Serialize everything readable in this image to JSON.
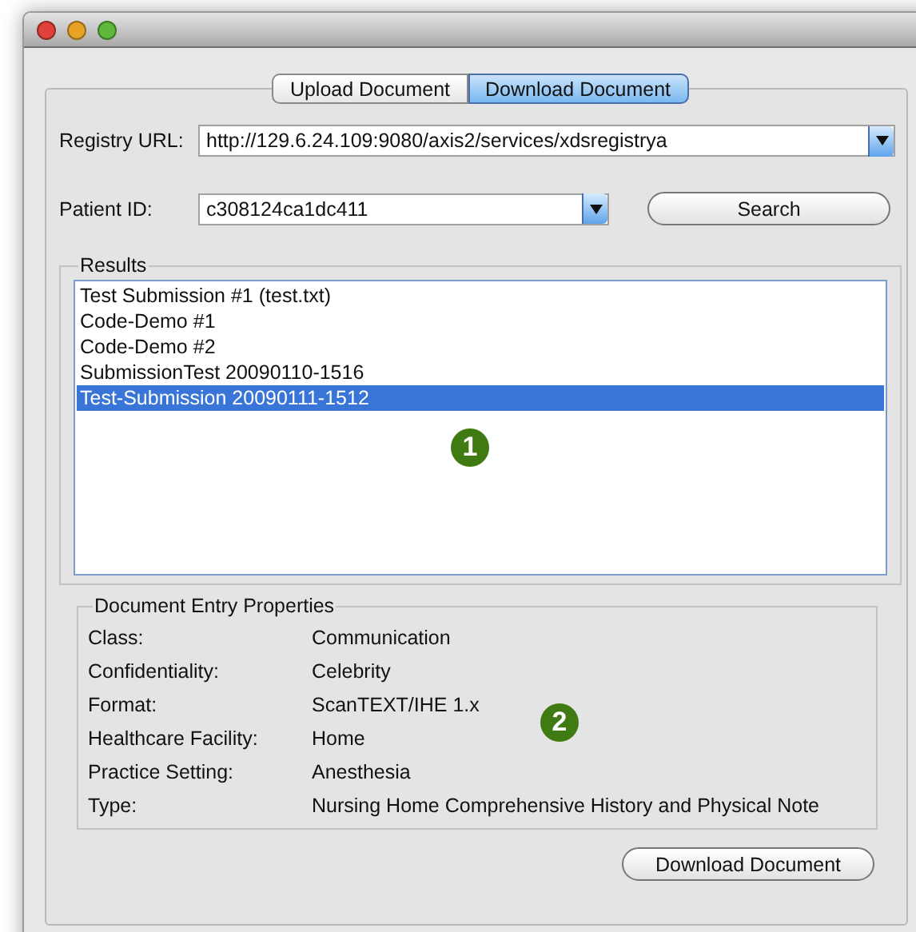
{
  "window": {
    "traffic_lights": [
      {
        "color": "#e0413a"
      },
      {
        "color": "#e8a326"
      },
      {
        "color": "#5fb83a"
      }
    ]
  },
  "tabs": [
    {
      "label": "Upload Document",
      "selected": false
    },
    {
      "label": "Download Document",
      "selected": true
    }
  ],
  "registry_url": {
    "label": "Registry URL:",
    "value": "http://129.6.24.109:9080/axis2/services/xdsregistrya"
  },
  "patient_id": {
    "label": "Patient ID:",
    "value": "c308124ca1dc411"
  },
  "search_button": "Search",
  "results": {
    "title": "Results",
    "items": [
      {
        "label": "Test Submission #1 (test.txt)",
        "selected": false
      },
      {
        "label": "Code-Demo #1",
        "selected": false
      },
      {
        "label": "Code-Demo #2",
        "selected": false
      },
      {
        "label": "SubmissionTest 20090110-1516",
        "selected": false
      },
      {
        "label": "Test-Submission 20090111-1512",
        "selected": true
      }
    ],
    "callout": "1"
  },
  "properties": {
    "title": "Document Entry Properties",
    "rows": [
      {
        "label": "Class:",
        "value": "Communication"
      },
      {
        "label": "Confidentiality:",
        "value": "Celebrity"
      },
      {
        "label": "Format:",
        "value": "ScanTEXT/IHE 1.x"
      },
      {
        "label": "Healthcare Facility:",
        "value": "Home"
      },
      {
        "label": "Practice Setting:",
        "value": "Anesthesia"
      },
      {
        "label": "Type:",
        "value": "Nursing Home Comprehensive History and Physical Note"
      }
    ],
    "callout": "2"
  },
  "download_button": "Download Document"
}
